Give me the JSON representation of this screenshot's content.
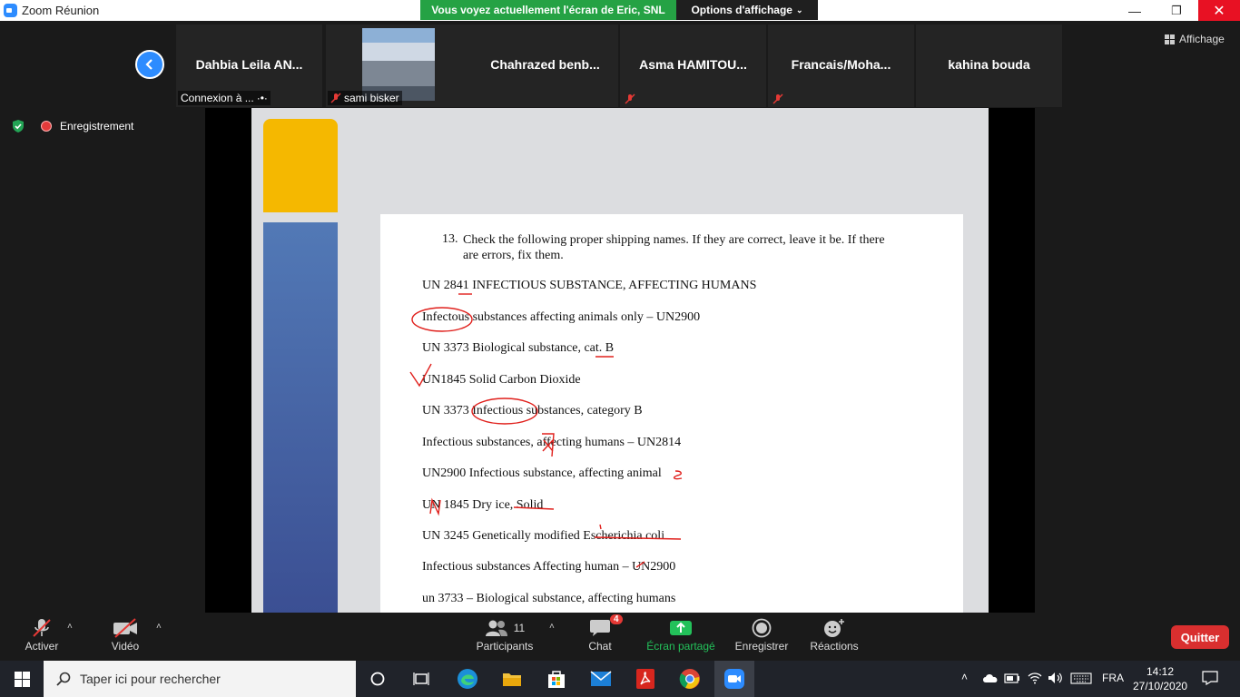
{
  "titlebar": {
    "app_title": "Zoom Réunion",
    "share_banner": "Vous voyez actuellement l'écran de Eric, SNL",
    "view_options": "Options d'affichage",
    "affichage": "Affichage"
  },
  "participants": [
    {
      "name": "Dahbia  Leila  AN...",
      "footer": "Connexion à ...",
      "muted": false
    },
    {
      "name": "",
      "footer": "sami bisker",
      "muted": true
    },
    {
      "name": "Chahrazed  benb...",
      "footer": "",
      "muted": false
    },
    {
      "name": "Asma  HAMITOU...",
      "footer": "",
      "muted": true
    },
    {
      "name": "Francais/Moha...",
      "footer": "",
      "muted": true
    },
    {
      "name": "kahina bouda",
      "footer": "",
      "muted": false
    }
  ],
  "recording": {
    "label": "Enregistrement"
  },
  "document": {
    "question_number": "13.",
    "question_text": "Check the following proper shipping names. If they are correct, leave it be. If there are errors, fix them.",
    "lines": [
      "UN 2841 INFECTIOUS SUBSTANCE, AFFECTING HUMANS",
      "Infectous substances affecting animals only – UN2900",
      "UN 3373 Biological substance, cat. B",
      "UN1845 Solid Carbon Dioxide",
      "UN 3373 Infectious substances, category B",
      "Infectious substances, affecting humans – UN2814",
      "UN2900 Infectious substance, affecting animal",
      "UN 1845 Dry ice, Solid",
      "UN 3245 Genetically modified Escherichia coli",
      "Infectious substances Affecting human – UN2900",
      "un 3733 – Biological substance, affecting humans"
    ]
  },
  "toolbar": {
    "mute_label": "Activer",
    "video_label": "Vidéo",
    "participants_label": "Participants",
    "participants_count": "11",
    "chat_label": "Chat",
    "chat_badge": "4",
    "share_label": "Écran partagé",
    "record_label": "Enregistrer",
    "reactions_label": "Réactions",
    "quit_label": "Quitter"
  },
  "taskbar": {
    "search_placeholder": "Taper ici pour rechercher",
    "language": "FRA",
    "time": "14:12",
    "date": "27/10/2020"
  },
  "colors": {
    "zoom_blue": "#2d8cff",
    "share_green": "#25a244",
    "quit_red": "#d92f2f",
    "slide_yellow": "#f5b800",
    "slide_blue": "#4a68a8",
    "annotation_red": "#e0201c"
  }
}
